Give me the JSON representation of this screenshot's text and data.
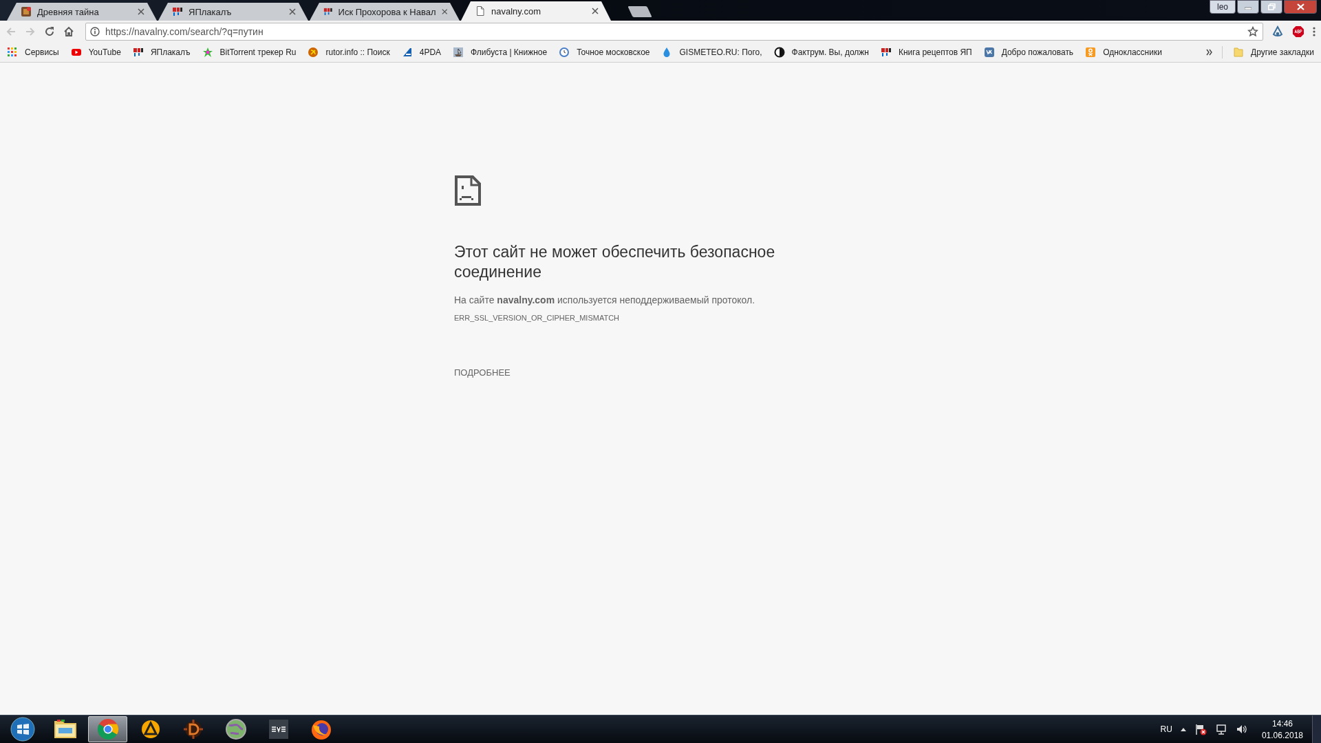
{
  "window": {
    "user": "leo"
  },
  "tabs": [
    {
      "title": "Древняя тайна",
      "selected": false
    },
    {
      "title": "ЯПлакалъ",
      "selected": false
    },
    {
      "title": "Иск Прохорова к Навал",
      "selected": false
    },
    {
      "title": "navalny.com",
      "selected": true
    }
  ],
  "toolbar": {
    "back_disabled": true,
    "forward_disabled": true,
    "url": "https://navalny.com/search/?q=путин"
  },
  "bookmarks": [
    {
      "label": "Сервисы"
    },
    {
      "label": "YouTube"
    },
    {
      "label": "ЯПлакалъ"
    },
    {
      "label": "BitTorrent трекер Ru"
    },
    {
      "label": "rutor.info :: Поиск"
    },
    {
      "label": "4PDA"
    },
    {
      "label": "Флибуста | Книжное"
    },
    {
      "label": "Точное московское"
    },
    {
      "label": "GISMETEO.RU: Пого,"
    },
    {
      "label": "Фактрум. Вы, должн"
    },
    {
      "label": "Книга рецептов ЯП"
    },
    {
      "label": "Добро пожаловать"
    },
    {
      "label": "Одноклассники"
    }
  ],
  "other_bookmarks": "Другие закладки",
  "error": {
    "title": "Этот сайт не может обеспечить безопасное соединение",
    "message": "На сайте **navalny.com** используется неподдерживаемый протокол.",
    "code": "ERR_SSL_VERSION_OR_CIPHER_MISMATCH",
    "details_button": "ПОДРОБНЕЕ"
  },
  "taskbar": {
    "apps": [
      {
        "kind": "explorer",
        "selected": false
      },
      {
        "kind": "chrome",
        "selected": true
      },
      {
        "kind": "aimp",
        "selected": false
      },
      {
        "kind": "diablo",
        "selected": false
      },
      {
        "kind": "globe",
        "selected": false
      },
      {
        "kind": "eve",
        "selected": false
      },
      {
        "kind": "firefox",
        "selected": false
      }
    ],
    "language": "RU",
    "time": "14:46",
    "date": "01.06.2018"
  }
}
